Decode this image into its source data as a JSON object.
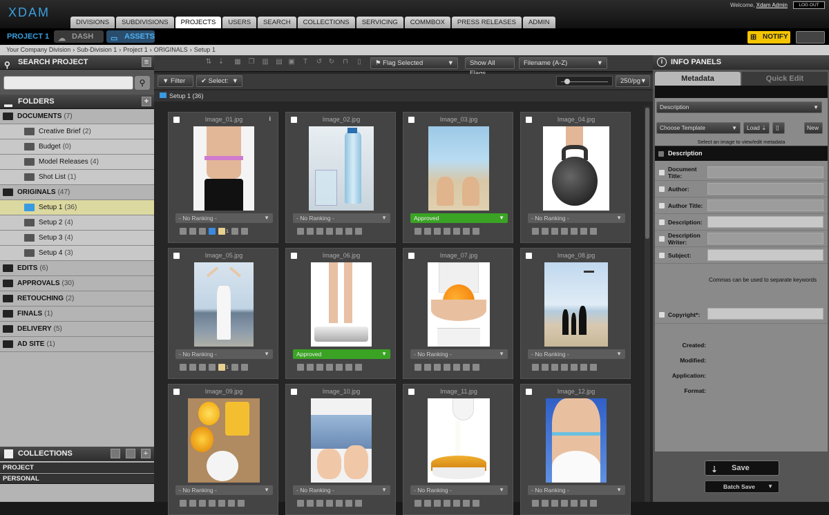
{
  "app": {
    "logo": "XDAM",
    "welcome": "Welcome,",
    "user": "Xdam Admin",
    "logout": "LOG OUT"
  },
  "nav": [
    "DIVISIONS",
    "SUBDIVISIONS",
    "PROJECTS",
    "USERS",
    "SEARCH",
    "COLLECTIONS",
    "SERVICING",
    "COMMBOX",
    "PRESS RELEASES",
    "ADMIN"
  ],
  "nav_active": "PROJECTS",
  "subbar": {
    "project": "PROJECT 1",
    "dash": "DASH",
    "assets": "ASSETS",
    "notify": "NOTIFY"
  },
  "breadcrumb": [
    "Your Company Division",
    "Sub-Division 1",
    "Project 1",
    "ORIGINALS",
    "Setup 1"
  ],
  "left": {
    "search_title": "SEARCH PROJECT",
    "folders_title": "FOLDERS",
    "folders": [
      {
        "name": "DOCUMENTS",
        "count": "(7)",
        "level": "top"
      },
      {
        "name": "Creative Brief",
        "count": "(2)",
        "level": "sub"
      },
      {
        "name": "Budget",
        "count": "(0)",
        "level": "sub"
      },
      {
        "name": "Model Releases",
        "count": "(4)",
        "level": "sub"
      },
      {
        "name": "Shot List",
        "count": "(1)",
        "level": "sub"
      },
      {
        "name": "ORIGINALS",
        "count": "(47)",
        "level": "top"
      },
      {
        "name": "Setup 1",
        "count": "(36)",
        "level": "sub",
        "selected": true
      },
      {
        "name": "Setup 2",
        "count": "(4)",
        "level": "sub"
      },
      {
        "name": "Setup 3",
        "count": "(4)",
        "level": "sub"
      },
      {
        "name": "Setup 4",
        "count": "(3)",
        "level": "sub"
      },
      {
        "name": "EDITS",
        "count": "(6)",
        "level": "top"
      },
      {
        "name": "APPROVALS",
        "count": "(30)",
        "level": "top"
      },
      {
        "name": "RETOUCHING",
        "count": "(2)",
        "level": "top"
      },
      {
        "name": "FINALS",
        "count": "(1)",
        "level": "top"
      },
      {
        "name": "DELIVERY",
        "count": "(5)",
        "level": "top"
      },
      {
        "name": "AD SITE",
        "count": "(1)",
        "level": "top"
      }
    ],
    "collections_title": "COLLECTIONS",
    "collections": [
      "PROJECT",
      "PERSONAL"
    ]
  },
  "toolbar": {
    "flag_selected": "Flag Selected",
    "show_all_flags": "Show All Flags",
    "sort": "Filename (A-Z)",
    "filter": "Filter",
    "select": "Select:",
    "per_page": "250/pg",
    "folder_label": "Setup 1",
    "folder_count": "(36)"
  },
  "images": [
    {
      "name": "Image_01.jpg",
      "ranking": "- No Ranking -",
      "approved": false,
      "info": true,
      "note_count": "1",
      "thumb": "waist",
      "thumb_w": 88
    },
    {
      "name": "Image_02.jpg",
      "ranking": "- No Ranking -",
      "approved": false,
      "thumb": "bottle",
      "thumb_w": 94
    },
    {
      "name": "Image_03.jpg",
      "ranking": "Approved",
      "approved": true,
      "thumb": "feet",
      "thumb_w": 88
    },
    {
      "name": "Image_04.jpg",
      "ranking": "- No Ranking -",
      "approved": false,
      "thumb": "kettlebell",
      "thumb_w": 96
    },
    {
      "name": "Image_05.jpg",
      "ranking": "- No Ranking -",
      "approved": false,
      "note_count": "1",
      "thumb": "beach",
      "thumb_w": 86
    },
    {
      "name": "Image_06.jpg",
      "ranking": "Approved",
      "approved": true,
      "thumb": "scale",
      "thumb_w": 88
    },
    {
      "name": "Image_07.jpg",
      "ranking": "- No Ranking -",
      "approved": false,
      "thumb": "orange",
      "thumb_w": 90
    },
    {
      "name": "Image_08.jpg",
      "ranking": "- No Ranking -",
      "approved": false,
      "thumb": "family",
      "thumb_w": 92
    },
    {
      "name": "Image_09.jpg",
      "ranking": "- No Ranking -",
      "approved": false,
      "thumb": "citrus",
      "thumb_w": 104
    },
    {
      "name": "Image_10.jpg",
      "ranking": "- No Ranking -",
      "approved": false,
      "thumb": "baby",
      "thumb_w": 88
    },
    {
      "name": "Image_11.jpg",
      "ranking": "- No Ranking -",
      "approved": false,
      "thumb": "milk",
      "thumb_w": 90
    },
    {
      "name": "Image_12.jpg",
      "ranking": "- No Ranking -",
      "approved": false,
      "thumb": "tape",
      "thumb_w": 88
    }
  ],
  "info_panel": {
    "title": "INFO PANELS",
    "tab_metadata": "Metadata",
    "tab_quick_edit": "Quick Edit",
    "field_select": "Description",
    "template_select": "Choose Template",
    "load": "Load",
    "new": "New",
    "hint": "Select an image to view/edit metadata",
    "section": "Description",
    "fields": [
      "Document Title:",
      "Author:",
      "Author Title:",
      "Description:",
      "Description Writer:",
      "Subject:"
    ],
    "keywords_hint": "Commas can be used to separate keywords",
    "copyright": "Copyright*:",
    "readonly": [
      "Created:",
      "Modified:",
      "Application:",
      "Format:"
    ],
    "save": "Save",
    "batch_save": "Batch Save"
  },
  "colors": {
    "accent": "#3aa0e0",
    "approved": "#3aa324",
    "notify": "#f5c400",
    "selected_folder": "#dcd9a0"
  }
}
